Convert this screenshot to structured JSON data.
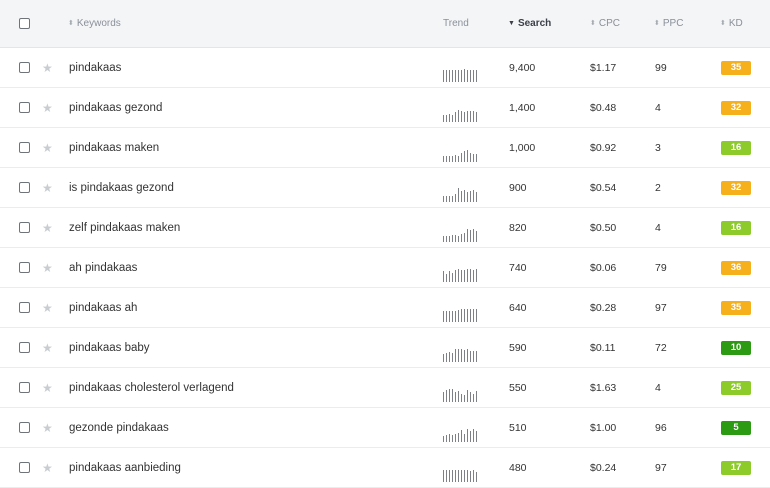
{
  "header": {
    "keywords_label": "Keywords",
    "trend_label": "Trend",
    "search_label": "Search",
    "cpc_label": "CPC",
    "ppc_label": "PPC",
    "kd_label": "KD",
    "sort_icon": "updown-arrows-icon",
    "active_sort_icon": "caret-down-icon"
  },
  "kd_colors": {
    "orange": "#f5b01b",
    "light_green": "#8dcb2a",
    "dark_green": "#2c9a12"
  },
  "rows": [
    {
      "keyword": "pindakaas",
      "search": "9,400",
      "cpc": "$1.17",
      "ppc": "99",
      "kd": "35",
      "kd_color": "#f5b01b",
      "trend": [
        0.85,
        0.85,
        0.85,
        0.85,
        0.85,
        0.85,
        0.85,
        0.9,
        0.85,
        0.85,
        0.85,
        0.85
      ]
    },
    {
      "keyword": "pindakaas gezond",
      "search": "1,400",
      "cpc": "$0.48",
      "ppc": "4",
      "kd": "32",
      "kd_color": "#f5b01b",
      "trend": [
        0.5,
        0.5,
        0.55,
        0.5,
        0.7,
        0.85,
        0.75,
        0.7,
        0.75,
        0.75,
        0.75,
        0.7
      ]
    },
    {
      "keyword": "pindakaas maken",
      "search": "1,000",
      "cpc": "$0.92",
      "ppc": "3",
      "kd": "16",
      "kd_color": "#8dcb2a",
      "trend": [
        0.4,
        0.45,
        0.45,
        0.45,
        0.5,
        0.45,
        0.65,
        0.75,
        0.85,
        0.65,
        0.55,
        0.6
      ]
    },
    {
      "keyword": "is pindakaas gezond",
      "search": "900",
      "cpc": "$0.54",
      "ppc": "2",
      "kd": "32",
      "kd_color": "#f5b01b",
      "trend": [
        0.4,
        0.4,
        0.4,
        0.45,
        0.6,
        1.0,
        0.75,
        0.85,
        0.7,
        0.75,
        0.85,
        0.7
      ]
    },
    {
      "keyword": "zelf pindakaas maken",
      "search": "820",
      "cpc": "$0.50",
      "ppc": "4",
      "kd": "16",
      "kd_color": "#8dcb2a",
      "trend": [
        0.45,
        0.45,
        0.45,
        0.5,
        0.5,
        0.45,
        0.55,
        0.65,
        0.95,
        0.85,
        0.9,
        0.8
      ]
    },
    {
      "keyword": "ah pindakaas",
      "search": "740",
      "cpc": "$0.06",
      "ppc": "79",
      "kd": "36",
      "kd_color": "#f5b01b",
      "trend": [
        0.75,
        0.6,
        0.75,
        0.65,
        0.85,
        0.9,
        0.85,
        0.85,
        0.9,
        0.9,
        0.85,
        0.9
      ]
    },
    {
      "keyword": "pindakaas ah",
      "search": "640",
      "cpc": "$0.28",
      "ppc": "97",
      "kd": "35",
      "kd_color": "#f5b01b",
      "trend": [
        0.75,
        0.75,
        0.75,
        0.75,
        0.8,
        0.85,
        0.9,
        0.9,
        0.9,
        0.9,
        0.9,
        0.9
      ]
    },
    {
      "keyword": "pindakaas baby",
      "search": "590",
      "cpc": "$0.11",
      "ppc": "72",
      "kd": "10",
      "kd_color": "#2c9a12",
      "trend": [
        0.6,
        0.65,
        0.7,
        0.65,
        0.9,
        0.95,
        0.9,
        0.85,
        0.9,
        0.8,
        0.8,
        0.75
      ]
    },
    {
      "keyword": "pindakaas cholesterol verlagend",
      "search": "550",
      "cpc": "$1.63",
      "ppc": "4",
      "kd": "25",
      "kd_color": "#8dcb2a",
      "trend": [
        0.7,
        0.85,
        0.9,
        0.95,
        0.7,
        0.8,
        0.55,
        0.5,
        0.85,
        0.7,
        0.55,
        0.8
      ]
    },
    {
      "keyword": "gezonde pindakaas",
      "search": "510",
      "cpc": "$1.00",
      "ppc": "96",
      "kd": "5",
      "kd_color": "#2c9a12",
      "trend": [
        0.45,
        0.5,
        0.55,
        0.5,
        0.6,
        0.65,
        0.85,
        0.55,
        0.9,
        0.8,
        0.9,
        0.8
      ]
    },
    {
      "keyword": "pindakaas aanbieding",
      "search": "480",
      "cpc": "$0.24",
      "ppc": "97",
      "kd": "17",
      "kd_color": "#8dcb2a",
      "trend": [
        0.85,
        0.85,
        0.85,
        0.85,
        0.85,
        0.85,
        0.85,
        0.85,
        0.85,
        0.8,
        0.85,
        0.7
      ]
    }
  ]
}
